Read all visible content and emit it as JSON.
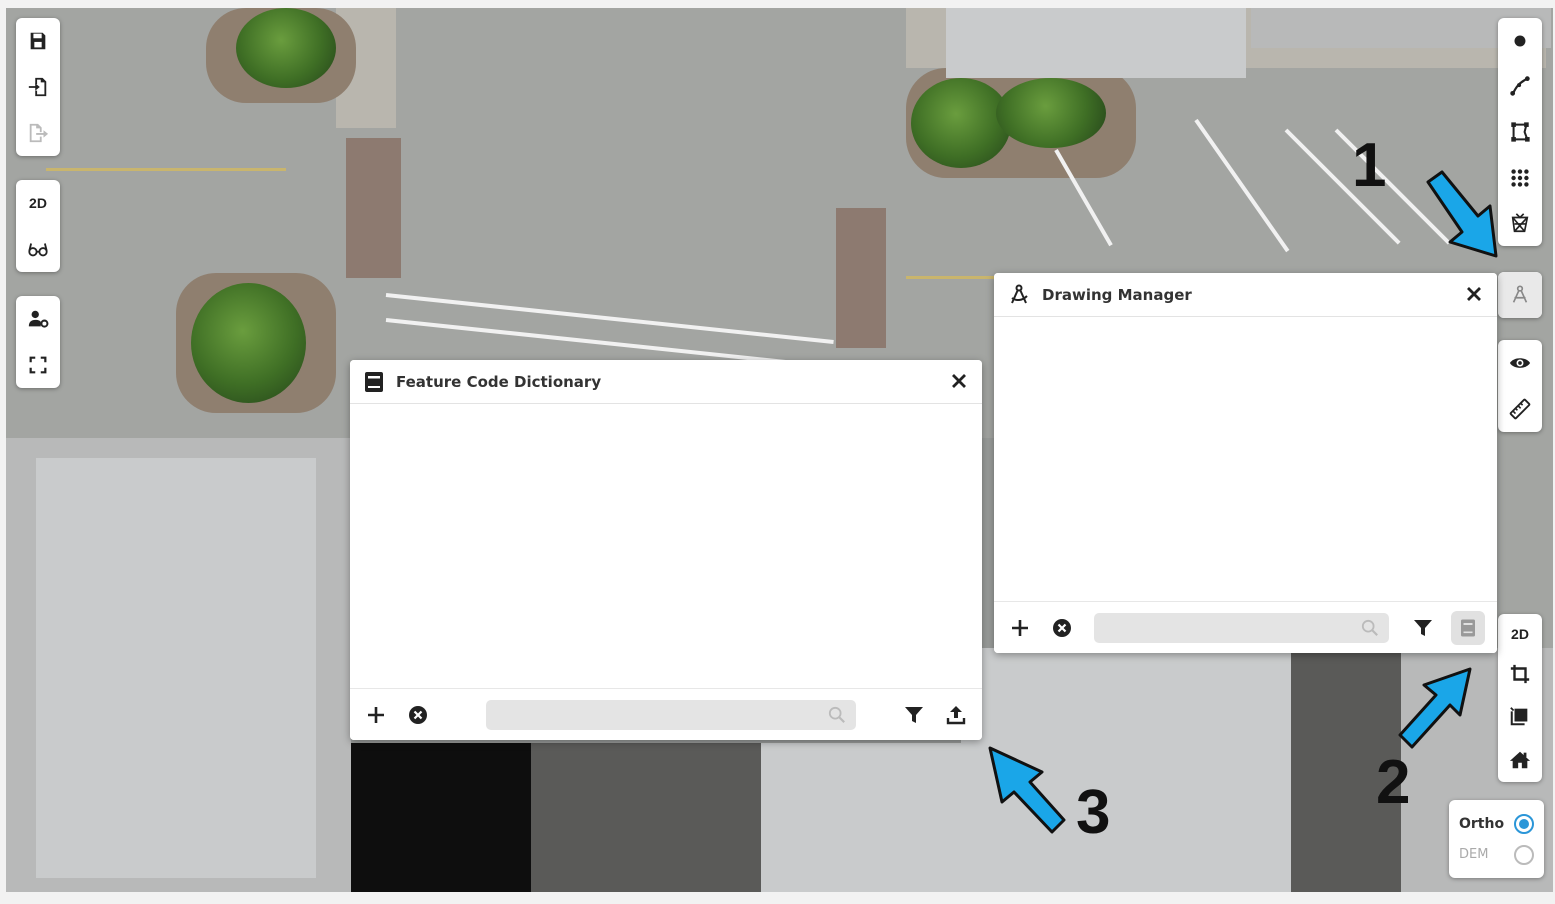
{
  "left_toolbar": {
    "group1": [
      {
        "icon": "save-icon"
      },
      {
        "icon": "file-import-icon"
      },
      {
        "icon": "file-export-icon"
      }
    ],
    "group2": [
      {
        "label": "2D"
      },
      {
        "icon": "glasses-icon"
      }
    ],
    "group3": [
      {
        "icon": "user-settings-icon"
      },
      {
        "icon": "fullscreen-icon"
      }
    ]
  },
  "right_toolbar": {
    "draw_group": [
      {
        "icon": "point-icon"
      },
      {
        "icon": "line-icon"
      },
      {
        "icon": "polygon-icon"
      },
      {
        "icon": "grid-icon"
      },
      {
        "icon": "mesh-icon"
      }
    ],
    "drawing_manager_icon": "compass-drafting-icon",
    "view_group": [
      {
        "icon": "eye-icon"
      },
      {
        "icon": "ruler-icon"
      }
    ],
    "bottom_group": [
      {
        "label": "2D"
      },
      {
        "icon": "crop-icon"
      },
      {
        "icon": "layers-icon"
      },
      {
        "icon": "home-icon"
      }
    ]
  },
  "feature_code_panel": {
    "title": "Feature Code Dictionary",
    "icon": "book-icon",
    "search_placeholder": ""
  },
  "drawing_manager_panel": {
    "title": "Drawing Manager",
    "icon": "compass-drafting-icon",
    "search_placeholder": ""
  },
  "layer_switch": {
    "options": [
      {
        "label": "Ortho",
        "selected": true
      },
      {
        "label": "DEM",
        "selected": false
      }
    ]
  },
  "annotations": {
    "one": "1",
    "two": "2",
    "three": "3",
    "arrow_color": "#1aa6e8"
  }
}
